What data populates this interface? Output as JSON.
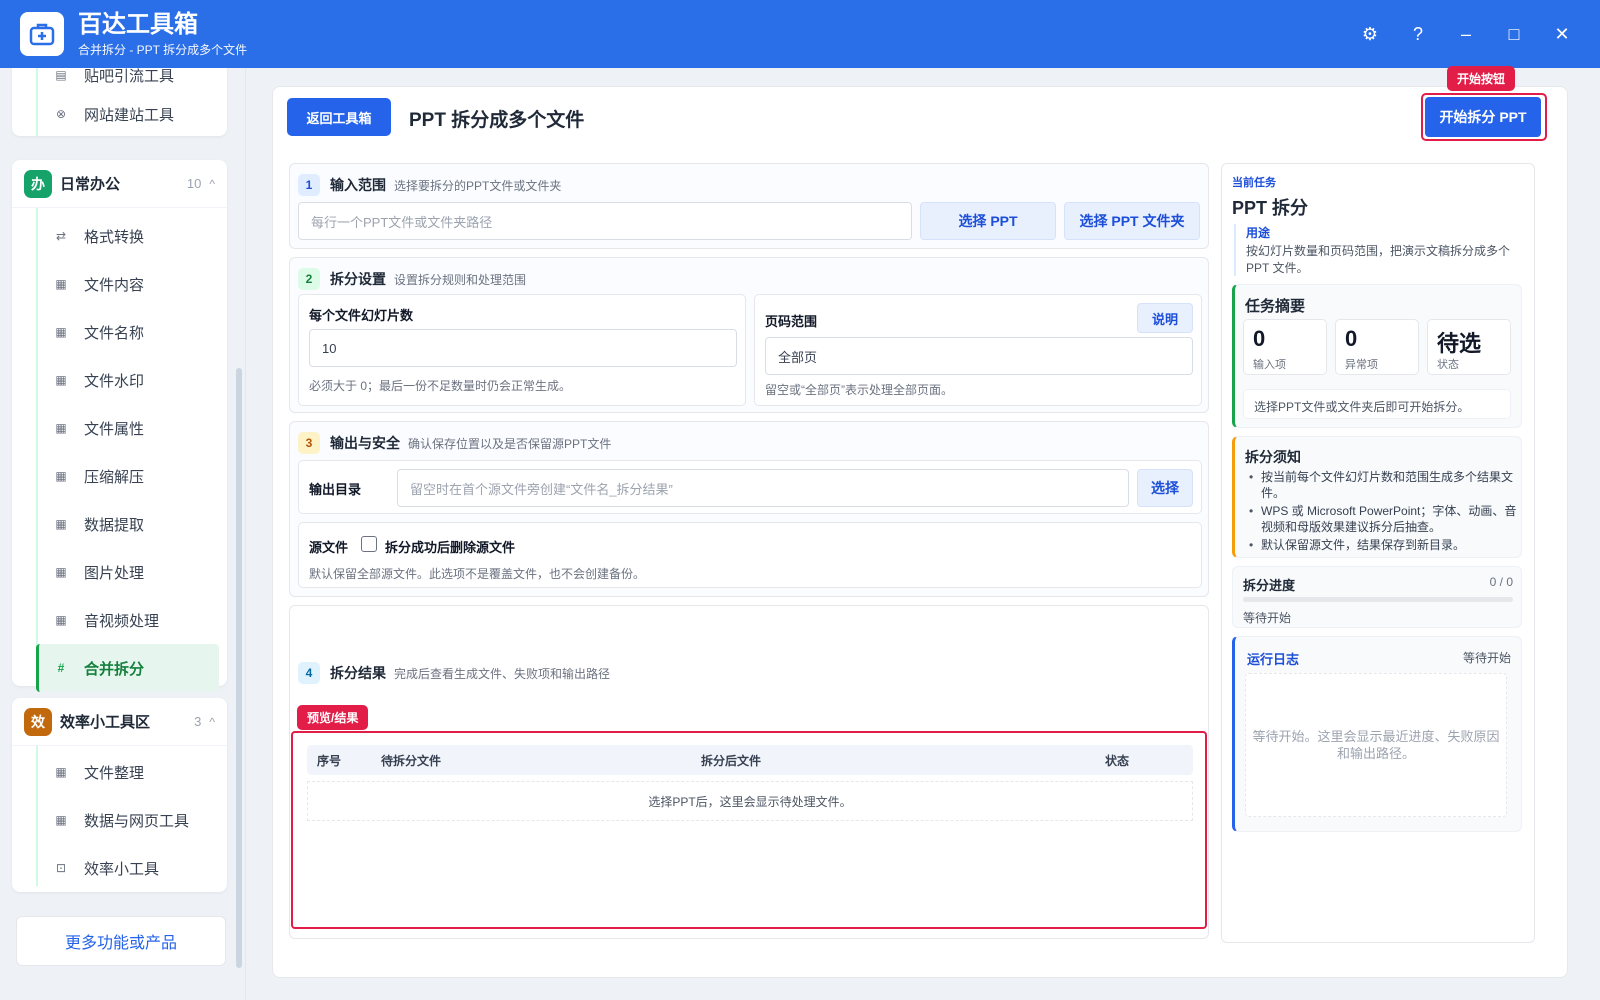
{
  "app": {
    "title": "百达工具箱",
    "subtitle": "合并拆分 - PPT 拆分成多个文件"
  },
  "window": {
    "settings": "⚙",
    "help": "?",
    "minimize": "–",
    "maximize": "□",
    "close": "✕"
  },
  "sidebar": {
    "top_items": [
      {
        "label": "贴吧引流工具"
      },
      {
        "label": "网站建站工具"
      }
    ],
    "group1": {
      "badge": "办",
      "title": "日常办公",
      "count": "10",
      "caret": "^",
      "items": [
        {
          "label": "格式转换"
        },
        {
          "label": "文件内容"
        },
        {
          "label": "文件名称"
        },
        {
          "label": "文件水印"
        },
        {
          "label": "文件属性"
        },
        {
          "label": "压缩解压"
        },
        {
          "label": "数据提取"
        },
        {
          "label": "图片处理"
        },
        {
          "label": "音视频处理"
        },
        {
          "label": "合并拆分"
        }
      ]
    },
    "group2": {
      "badge": "效",
      "title": "效率小工具区",
      "count": "3",
      "caret": "^",
      "items": [
        {
          "label": "文件整理"
        },
        {
          "label": "数据与网页工具"
        },
        {
          "label": "效率小工具"
        }
      ]
    },
    "more": "更多功能或产品"
  },
  "main": {
    "back": "返回工具箱",
    "title": "PPT 拆分成多个文件",
    "start": "开始拆分 PPT",
    "start_tag": "开始按钮",
    "s1": {
      "num": "1",
      "title": "输入范围",
      "desc": "选择要拆分的PPT文件或文件夹",
      "placeholder": "每行一个PPT文件或文件夹路径",
      "btn_ppt": "选择 PPT",
      "btn_folder": "选择 PPT 文件夹"
    },
    "s2": {
      "num": "2",
      "title": "拆分设置",
      "desc": "设置拆分规则和处理范围",
      "slides_label": "每个文件幻灯片数",
      "slides_value": "10",
      "slides_hint": "必须大于 0；最后一份不足数量时仍会正常生成。",
      "range_label": "页码范围",
      "range_help": "说明",
      "range_value": "全部页",
      "range_hint": "留空或“全部页”表示处理全部页面。"
    },
    "s3": {
      "num": "3",
      "title": "输出与安全",
      "desc": "确认保存位置以及是否保留源PPT文件",
      "out_label": "输出目录",
      "out_placeholder": "留空时在首个源文件旁创建“文件名_拆分结果”",
      "out_btn": "选择",
      "src_label": "源文件",
      "src_check": "拆分成功后删除源文件",
      "src_hint": "默认保留全部源文件。此选项不是覆盖文件，也不会创建备份。"
    },
    "s4": {
      "num": "4",
      "title": "拆分结果",
      "desc": "完成后查看生成文件、失败项和输出路径",
      "preview_tag": "预览/结果",
      "columns": [
        "序号",
        "待拆分文件",
        "拆分后文件",
        "状态"
      ],
      "empty": "选择PPT后，这里会显示待处理文件。"
    }
  },
  "right": {
    "task_label": "当前任务",
    "task_title": "PPT 拆分",
    "usage_label": "用途",
    "usage_text": "按幻灯片数量和页码范围，把演示文稿拆分成多个 PPT 文件。",
    "summary_title": "任务摘要",
    "stats": [
      {
        "value": "0",
        "label": "输入项"
      },
      {
        "value": "0",
        "label": "异常项"
      },
      {
        "value": "待选",
        "label": "状态"
      }
    ],
    "summary_hint": "选择PPT文件或文件夹后即可开始拆分。",
    "notice_title": "拆分须知",
    "notices": [
      "按当前每个文件幻灯片数和范围生成多个结果文件。",
      "WPS 或 Microsoft PowerPoint；字体、动画、音视频和母版效果建议拆分后抽查。",
      "默认保留源文件，结果保存到新目录。"
    ],
    "progress_title": "拆分进度",
    "progress_count": "0 / 0",
    "progress_value": 0,
    "progress_status": "等待开始",
    "log_title": "运行日志",
    "log_status": "等待开始",
    "log_text": "等待开始。这里会显示最近进度、失败原因和输出路径。"
  },
  "colors": {
    "brand": "#2b6fe8",
    "accent": "#2563eb",
    "highlight": "#e11d48",
    "active": "#16a34a"
  }
}
